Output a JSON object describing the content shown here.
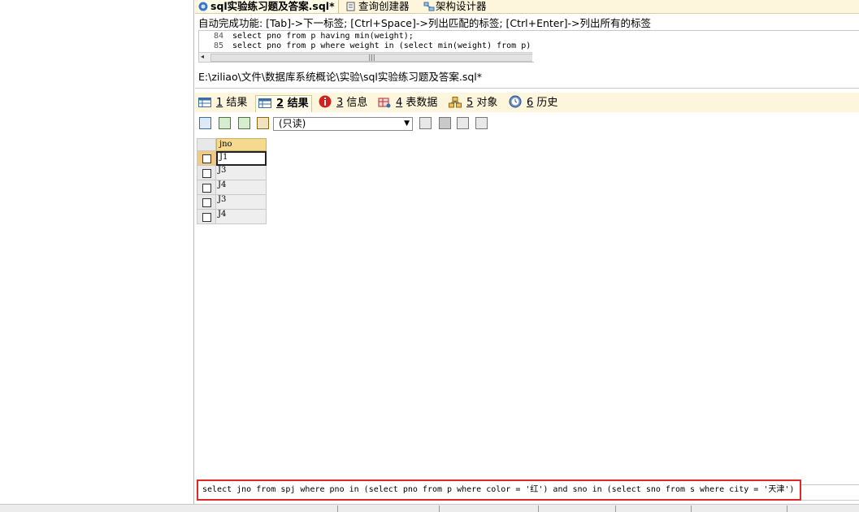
{
  "tabs": [
    {
      "label": "sql实验练习题及答案.sql*",
      "active": true,
      "icon": "sql-file-icon"
    },
    {
      "label": "查询创建器",
      "active": false,
      "icon": "query-builder-icon"
    },
    {
      "label": "架构设计器",
      "active": false,
      "icon": "schema-designer-icon"
    }
  ],
  "hint": "自动完成功能: [Tab]->下一标签; [Ctrl+Space]->列出匹配的标签; [Ctrl+Enter]->列出所有的标签",
  "editor": {
    "lines": [
      {
        "num": "84",
        "text": "select pno from p having min(weight);"
      },
      {
        "num": "85",
        "text": "select pno from p where weight in (select min(weight) from p);"
      }
    ],
    "scroll_marker": "|||"
  },
  "file_path": "E:\\ziliao\\文件\\数据库系统概论\\实验\\sql实验练习题及答案.sql*",
  "result_tabs": [
    {
      "num": "1",
      "label": "结果",
      "icon": "result-grid-icon",
      "active": false
    },
    {
      "num": "2",
      "label": "结果",
      "icon": "result-grid-icon",
      "active": true
    },
    {
      "num": "3",
      "label": "信息",
      "icon": "info-icon",
      "active": false
    },
    {
      "num": "4",
      "label": "表数据",
      "icon": "table-data-icon",
      "active": false
    },
    {
      "num": "5",
      "label": "对象",
      "icon": "objects-icon",
      "active": false
    },
    {
      "num": "6",
      "label": "历史",
      "icon": "history-icon",
      "active": false
    }
  ],
  "toolbar": {
    "mode_select": "(只读)"
  },
  "grid": {
    "column": "jno",
    "rows": [
      "J1",
      "J3",
      "J4",
      "J3",
      "J4"
    ]
  },
  "sql_query": "select jno from spj where pno in (select pno from p where color = '红') and sno in (select sno from s where city = '天津')",
  "colors": {
    "accent": "#fdf6dc",
    "highlight": "#e02828",
    "grid_header": "#f5d98e"
  }
}
